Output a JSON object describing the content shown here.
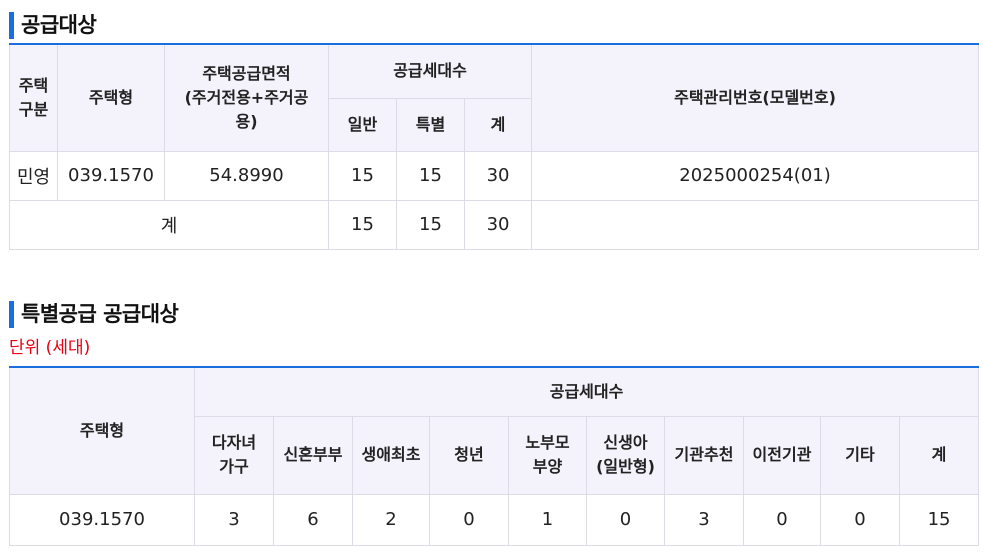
{
  "section1": {
    "title": "공급대상",
    "headers": {
      "house_type_group": "주택\n구분",
      "house_type": "주택형",
      "area": "주택공급면적\n(주거전용+주거공\n용)",
      "households": "공급세대수",
      "general": "일반",
      "special": "특별",
      "total": "계",
      "management_no": "주택관리번호(모델번호)"
    },
    "rows": [
      {
        "group": "민영",
        "type": "039.1570",
        "area": "54.8990",
        "general": "15",
        "special": "15",
        "total": "30",
        "management_no": "2025000254(01)"
      }
    ],
    "summary": {
      "label": "계",
      "general": "15",
      "special": "15",
      "total": "30"
    }
  },
  "section2": {
    "title": "특별공급 공급대상",
    "unit": "단위 (세대)",
    "headers": {
      "house_type": "주택형",
      "households": "공급세대수",
      "columns": [
        "다자녀\n가구",
        "신혼부부",
        "생애최초",
        "청년",
        "노부모\n부양",
        "신생아\n(일반형)",
        "기관추천",
        "이전기관",
        "기타",
        "계"
      ]
    },
    "rows": [
      {
        "type": "039.1570",
        "values": [
          "3",
          "6",
          "2",
          "0",
          "1",
          "0",
          "3",
          "0",
          "0",
          "15"
        ]
      }
    ]
  }
}
